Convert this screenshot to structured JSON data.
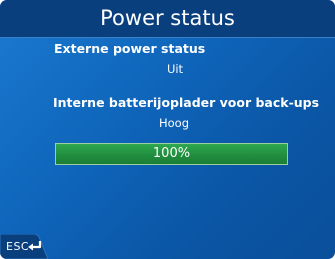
{
  "window": {
    "title": "Power status"
  },
  "external_power": {
    "label": "Externe power status",
    "value": "Uit"
  },
  "internal_charger": {
    "label": "Interne batterijoplader voor back-ups",
    "value": "Hoog"
  },
  "battery": {
    "level_text": "100%",
    "level_fraction": 1.0,
    "fill_color": "#218e3f"
  },
  "footer": {
    "esc_label": "ESC",
    "esc_icon": "back-arrow-icon"
  },
  "colors": {
    "background": "#0e63b8",
    "title_bar": "#0a3f7e",
    "progress_track": "#0b3d77"
  }
}
